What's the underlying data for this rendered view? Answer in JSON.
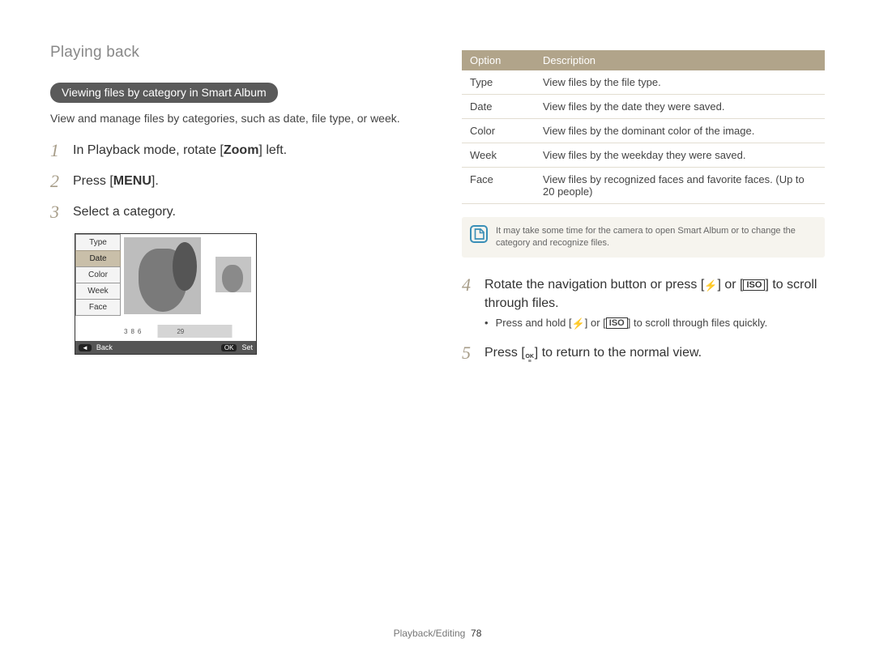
{
  "header": {
    "section_title": "Playing back"
  },
  "left": {
    "pill": "Viewing files by category in Smart Album",
    "intro": "View and manage files by categories, such as date, file type, or week.",
    "steps": {
      "s1_pre": "In Playback mode, rotate [",
      "s1_bold": "Zoom",
      "s1_post": "] left.",
      "s2_pre": "Press [",
      "s2_bold": "MENU",
      "s2_post": "].",
      "s3": "Select a category."
    },
    "camera": {
      "menu": [
        "Type",
        "Date",
        "Color",
        "Week",
        "Face"
      ],
      "active_index": 1,
      "timeline_labels": [
        "3",
        "8",
        "6",
        "29"
      ],
      "bottom": {
        "back_key": "◄",
        "back_label": "Back",
        "set_key": "OK",
        "set_label": "Set"
      }
    }
  },
  "right": {
    "table": {
      "head_option": "Option",
      "head_desc": "Description",
      "rows": [
        {
          "opt": "Type",
          "desc": "View files by the file type."
        },
        {
          "opt": "Date",
          "desc": "View files by the date they were saved."
        },
        {
          "opt": "Color",
          "desc": "View files by the dominant color of the image."
        },
        {
          "opt": "Week",
          "desc": "View files by the weekday they were saved."
        },
        {
          "opt": "Face",
          "desc": "View files by recognized faces and favorite faces. (Up to 20 people)"
        }
      ]
    },
    "note": "It may take some time for the camera to open Smart Album or to change the category and recognize files.",
    "steps": {
      "s4_pre": "Rotate the navigation button or press [",
      "s4_mid": "] or [",
      "s4_post": "] to scroll through files.",
      "s4_sub_pre": "Press and hold [",
      "s4_sub_mid": "] or [",
      "s4_sub_post": "] to scroll through files quickly.",
      "s5_pre": "Press [",
      "s5_post": "] to return to the normal view."
    },
    "glyphs": {
      "iso": "ISO",
      "flash": "⚡",
      "ok_top": "OK",
      "ok_bottom": "≡"
    }
  },
  "footer": {
    "label": "Playback/Editing",
    "page": "78"
  }
}
